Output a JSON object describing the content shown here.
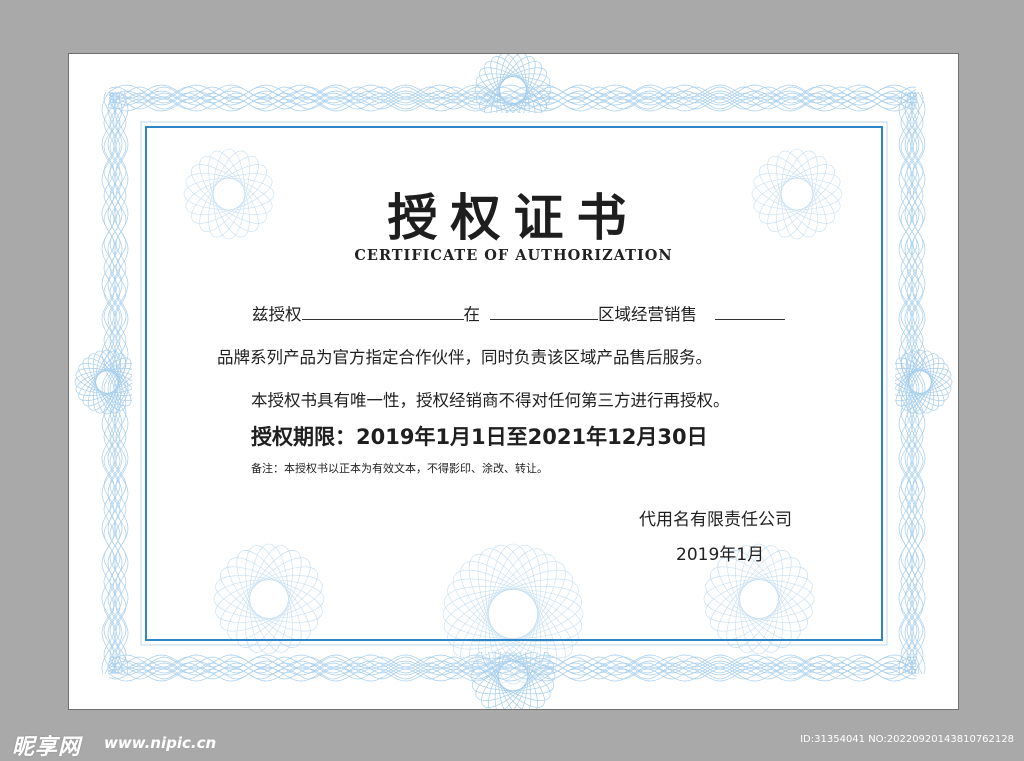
{
  "certificate": {
    "title": "授权证书",
    "subtitle": "CERTIFICATE OF AUTHORIZATION",
    "line1": {
      "part1": "兹授权",
      "part2": "在",
      "part3": "区域经营销售"
    },
    "line2": "品牌系列产品为官方指定合作伙伴，同时负责该区域产品售后服务。",
    "line3": "本授权书具有唯一性，授权经销商不得对任何第三方进行再授权。",
    "period": "授权期限：2019年1月1日至2021年12月30日",
    "note": "备注：本授权书以正本为有效文本，不得影印、涂改、转让。",
    "company": "代用名有限责任公司",
    "date": "2019年1月"
  },
  "watermark": {
    "logo_text": "昵享网",
    "url": "www.nipic.cn",
    "id_text": "ID:31354041 NO:20220920143810762128"
  },
  "colors": {
    "frame_blue": "#2f86c6",
    "guilloche_blue": "#9cc8ea",
    "background_gray": "#a9a9a9"
  }
}
